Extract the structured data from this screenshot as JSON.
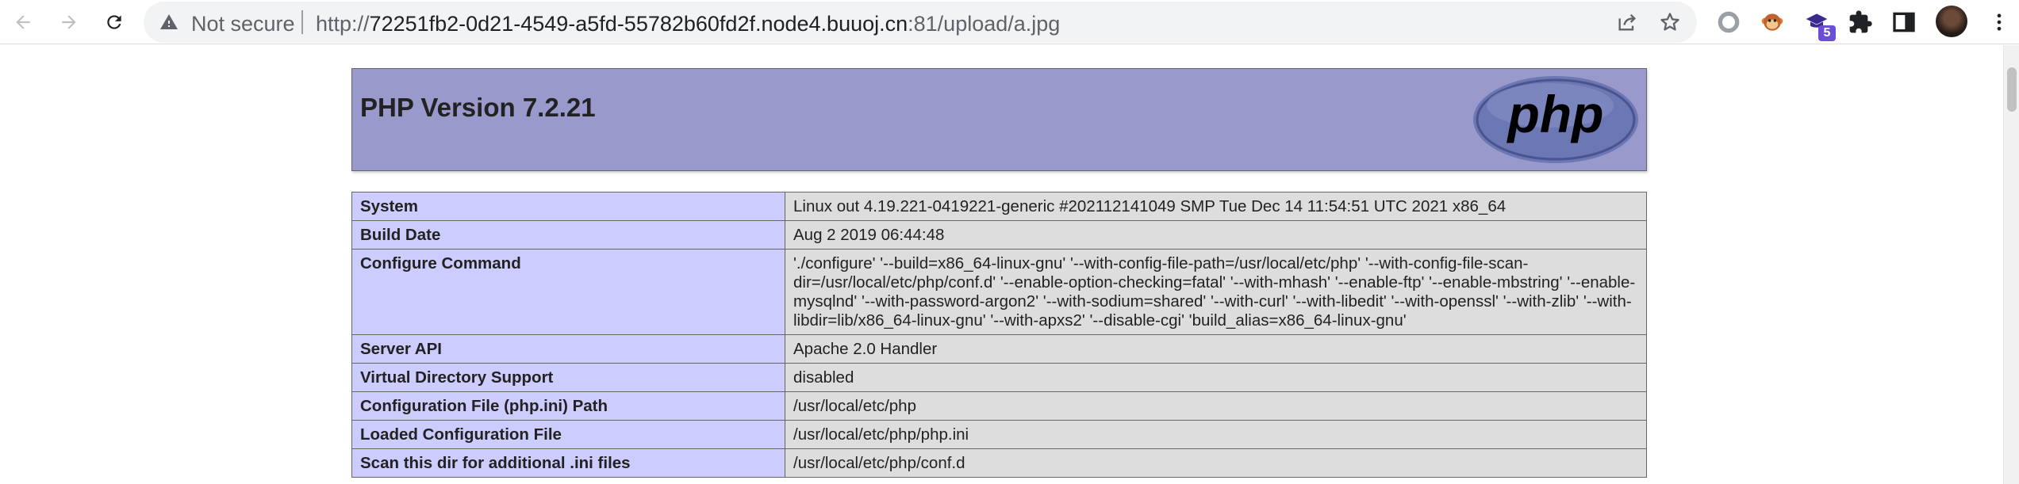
{
  "browser": {
    "security_label": "Not secure",
    "url_prefix": "http://",
    "url_host": "72251fb2-0d21-4549-a5fd-55782b60fd2f.node4.buuoj.cn",
    "url_rest": ":81/upload/a.jpg",
    "extension_badge": "5",
    "icons": [
      "back-arrow-icon",
      "forward-arrow-icon",
      "reload-icon",
      "warning-triangle-icon",
      "share-icon",
      "star-icon",
      "circle-extension-icon",
      "monkey-extension-icon",
      "graduation-cap-extension-icon",
      "puzzle-icon",
      "sidebar-icon",
      "avatar",
      "kebab-menu-icon"
    ]
  },
  "page": {
    "title": "PHP Version 7.2.21",
    "logo_text": "php",
    "colors": {
      "header_bg": "#9999cc",
      "label_bg": "#ccccff",
      "value_bg": "#dddddd",
      "border": "#666666"
    },
    "rows": [
      {
        "label": "System",
        "value": "Linux out 4.19.221-0419221-generic #202112141049 SMP Tue Dec 14 11:54:51 UTC 2021 x86_64"
      },
      {
        "label": "Build Date",
        "value": "Aug 2 2019 06:44:48"
      },
      {
        "label": "Configure Command",
        "value": "'./configure' '--build=x86_64-linux-gnu' '--with-config-file-path=/usr/local/etc/php' '--with-config-file-scan-dir=/usr/local/etc/php/conf.d' '--enable-option-checking=fatal' '--with-mhash' '--enable-ftp' '--enable-mbstring' '--enable-mysqlnd' '--with-password-argon2' '--with-sodium=shared' '--with-curl' '--with-libedit' '--with-openssl' '--with-zlib' '--with-libdir=lib/x86_64-linux-gnu' '--with-apxs2' '--disable-cgi' 'build_alias=x86_64-linux-gnu'"
      },
      {
        "label": "Server API",
        "value": "Apache 2.0 Handler"
      },
      {
        "label": "Virtual Directory Support",
        "value": "disabled"
      },
      {
        "label": "Configuration File (php.ini) Path",
        "value": "/usr/local/etc/php"
      },
      {
        "label": "Loaded Configuration File",
        "value": "/usr/local/etc/php/php.ini"
      },
      {
        "label": "Scan this dir for additional .ini files",
        "value": "/usr/local/etc/php/conf.d"
      }
    ]
  }
}
